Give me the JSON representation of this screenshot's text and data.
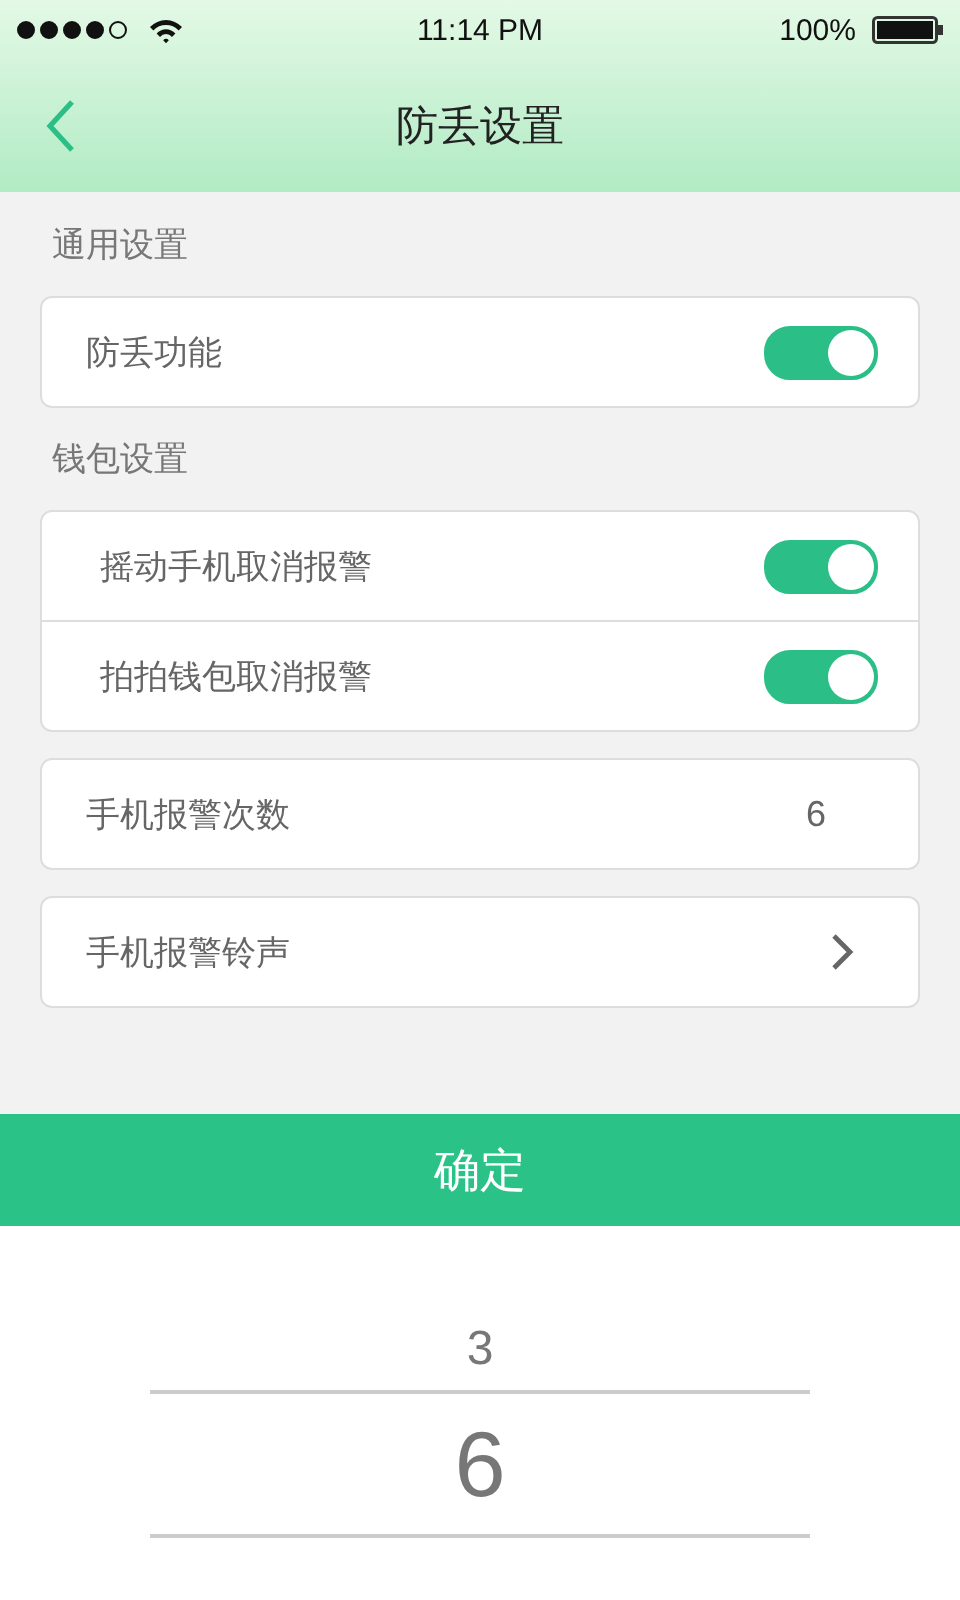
{
  "status_bar": {
    "time": "11:14 PM",
    "battery": "100%"
  },
  "nav": {
    "title": "防丢设置"
  },
  "sections": [
    {
      "label": "通用设置",
      "groups": [
        [
          {
            "kind": "toggle",
            "label": "防丢功能",
            "on": true
          }
        ]
      ]
    },
    {
      "label": "钱包设置",
      "groups": [
        [
          {
            "kind": "toggle",
            "label": "摇动手机取消报警",
            "on": true
          },
          {
            "kind": "toggle",
            "label": "拍拍钱包取消报警",
            "on": true
          }
        ],
        [
          {
            "kind": "value",
            "label": "手机报警次数",
            "value": "6"
          }
        ],
        [
          {
            "kind": "link",
            "label": "手机报警铃声"
          }
        ]
      ]
    }
  ],
  "confirm_button": "确定",
  "picker": [
    {
      "label": "3",
      "selected": false
    },
    {
      "label": "6",
      "selected": true
    }
  ]
}
